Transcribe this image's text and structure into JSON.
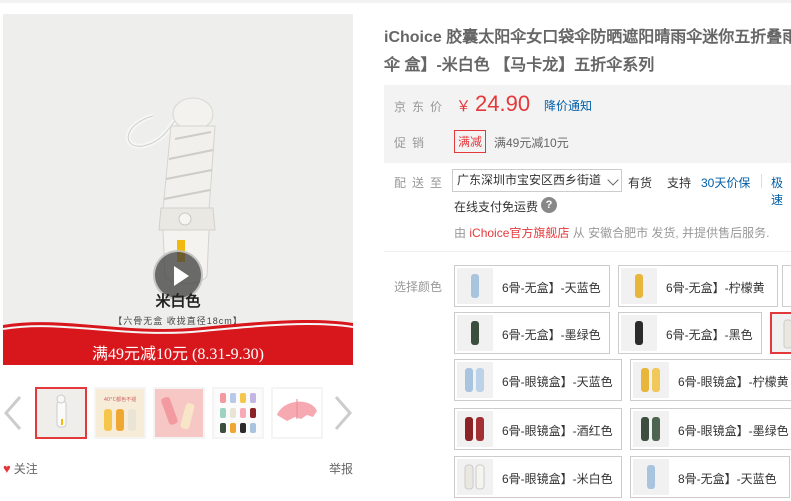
{
  "gallery": {
    "color_caption": "米白色",
    "sub_caption": "【六骨无盒 收拢直径18cm】",
    "promo_banner": "满49元减10元 (8.31-9.30)",
    "thumb_caption": "40°C都色不褪"
  },
  "actions": {
    "follow_label": "关注",
    "report_label": "举报"
  },
  "product": {
    "title": "iChoice 胶囊太阳伞女口袋伞防晒遮阳晴雨伞迷你五折叠雨伞 盒】-米白色 【马卡龙】五折伞系列"
  },
  "price": {
    "label": "京东价",
    "currency": "￥",
    "value": "24.90",
    "notify_label": "降价通知"
  },
  "promotion": {
    "label": "促销",
    "tag": "满减",
    "text": "满49元减10元"
  },
  "shipping": {
    "label": "配送至",
    "address": "广东深圳市宝安区西乡街道",
    "stock": "有货",
    "support_label": "支持",
    "service_1": "30天价保",
    "service_2": "极速",
    "online_pay": "在线支付免运费",
    "from_prefix": "由",
    "shop": "iChoice官方旗舰店",
    "from_suffix": "从 安徽合肥市 发货, 并提供售后服务."
  },
  "colors": {
    "label": "选择颜色",
    "options": [
      {
        "label": "6骨-无盒】-天蓝色",
        "swatch": "#a9c4de"
      },
      {
        "label": "6骨-无盒】-柠檬黄",
        "swatch": "#e9b63c"
      },
      {
        "label": "6骨-无盒】-墨绿色",
        "swatch": "#3c4f3f"
      },
      {
        "label": "6骨-无盒】-黑色",
        "swatch": "#2b2b2b"
      },
      {
        "label": "6骨-眼镜盒】-天蓝色",
        "swatch": "#a9c4de"
      },
      {
        "label": "6骨-眼镜盒】-柠檬黄",
        "swatch": "#e9b63c"
      },
      {
        "label": "6骨-眼镜盒】-酒红色",
        "swatch": "#8a2226"
      },
      {
        "label": "6骨-眼镜盒】-墨绿色",
        "swatch": "#3c4f3f"
      },
      {
        "label": "6骨-眼镜盒】-米白色",
        "swatch": "#e9e7e0"
      },
      {
        "label": "8骨-无盒】-天蓝色",
        "swatch": "#a9c4de"
      }
    ]
  }
}
